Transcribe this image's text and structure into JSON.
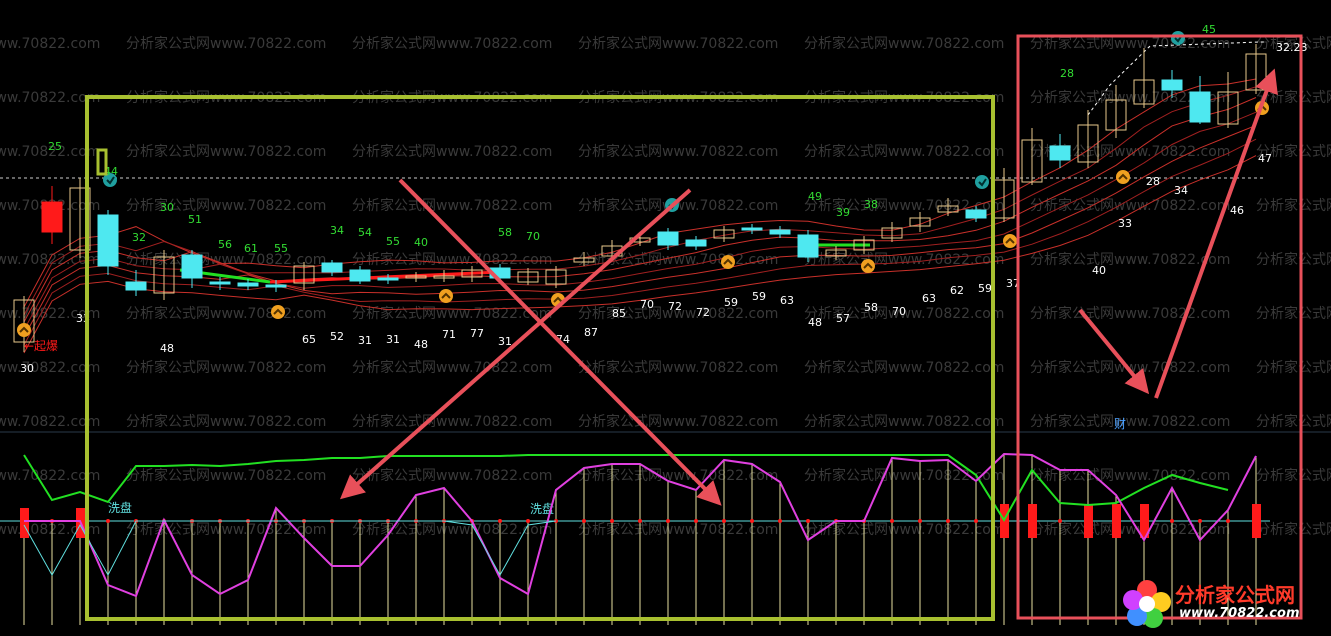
{
  "colors": {
    "background": "#000000",
    "bull_candle": "#e8c98c",
    "bear_candle": "#4ee8f0",
    "up_bar_red": "#ff1a1a",
    "ma_band": "#c8302a",
    "green_line": "#22e022",
    "magenta_line": "#e040e0",
    "cyan_line": "#60e0e0",
    "annotation_red": "#e8505a",
    "highlight_box_green": "#a8c030",
    "highlight_box_red": "#e8505a",
    "watermark": "#3a3a3a",
    "label_green": "#33dd33",
    "label_white": "#ffffff"
  },
  "watermark_text": "分析家公式网www.70822.com",
  "chart_data": {
    "type": "candlestick",
    "candles": [
      {
        "o": 300,
        "c": 342,
        "h": 352,
        "l": 296,
        "bull": true
      },
      {
        "o": 232,
        "c": 202,
        "h": 244,
        "l": 186,
        "bull": false,
        "red": true
      },
      {
        "o": 188,
        "c": 250,
        "h": 258,
        "l": 178,
        "bull": true
      },
      {
        "o": 215,
        "c": 266,
        "h": 275,
        "l": 210,
        "bull": false
      },
      {
        "o": 282,
        "c": 290,
        "h": 296,
        "l": 270,
        "bull": false
      },
      {
        "o": 293,
        "c": 257,
        "h": 300,
        "l": 250,
        "bull": true
      },
      {
        "o": 255,
        "c": 278,
        "h": 288,
        "l": 250,
        "bull": false
      },
      {
        "o": 282,
        "c": 283,
        "h": 290,
        "l": 277,
        "bull": false
      },
      {
        "o": 283,
        "c": 286,
        "h": 290,
        "l": 279,
        "bull": false
      },
      {
        "o": 285,
        "c": 286,
        "h": 292,
        "l": 280,
        "bull": false
      },
      {
        "o": 283,
        "c": 266,
        "h": 290,
        "l": 262,
        "bull": true
      },
      {
        "o": 263,
        "c": 272,
        "h": 276,
        "l": 260,
        "bull": false
      },
      {
        "o": 270,
        "c": 281,
        "h": 284,
        "l": 266,
        "bull": false
      },
      {
        "o": 278,
        "c": 280,
        "h": 284,
        "l": 274,
        "bull": false
      },
      {
        "o": 278,
        "c": 276,
        "h": 282,
        "l": 272,
        "bull": true
      },
      {
        "o": 276,
        "c": 276,
        "h": 282,
        "l": 270,
        "bull": true
      },
      {
        "o": 277,
        "c": 270,
        "h": 282,
        "l": 266,
        "bull": true
      },
      {
        "o": 268,
        "c": 278,
        "h": 282,
        "l": 264,
        "bull": false
      },
      {
        "o": 282,
        "c": 272,
        "h": 285,
        "l": 268,
        "bull": true
      },
      {
        "o": 284,
        "c": 270,
        "h": 288,
        "l": 266,
        "bull": true
      },
      {
        "o": 262,
        "c": 258,
        "h": 266,
        "l": 252,
        "bull": true
      },
      {
        "o": 256,
        "c": 246,
        "h": 260,
        "l": 240,
        "bull": true
      },
      {
        "o": 242,
        "c": 238,
        "h": 246,
        "l": 232,
        "bull": true
      },
      {
        "o": 232,
        "c": 245,
        "h": 250,
        "l": 228,
        "bull": false
      },
      {
        "o": 240,
        "c": 246,
        "h": 250,
        "l": 236,
        "bull": false
      },
      {
        "o": 238,
        "c": 230,
        "h": 242,
        "l": 226,
        "bull": true
      },
      {
        "o": 228,
        "c": 230,
        "h": 234,
        "l": 224,
        "bull": false
      },
      {
        "o": 230,
        "c": 234,
        "h": 238,
        "l": 226,
        "bull": false
      },
      {
        "o": 235,
        "c": 257,
        "h": 262,
        "l": 230,
        "bull": false
      },
      {
        "o": 256,
        "c": 250,
        "h": 260,
        "l": 246,
        "bull": true
      },
      {
        "o": 250,
        "c": 240,
        "h": 254,
        "l": 236,
        "bull": true
      },
      {
        "o": 238,
        "c": 228,
        "h": 242,
        "l": 222,
        "bull": true
      },
      {
        "o": 226,
        "c": 218,
        "h": 232,
        "l": 212,
        "bull": true
      },
      {
        "o": 212,
        "c": 206,
        "h": 216,
        "l": 198,
        "bull": true
      },
      {
        "o": 210,
        "c": 218,
        "h": 222,
        "l": 206,
        "bull": false
      },
      {
        "o": 218,
        "c": 180,
        "h": 222,
        "l": 168,
        "bull": true
      },
      {
        "o": 182,
        "c": 140,
        "h": 185,
        "l": 128,
        "bull": true
      },
      {
        "o": 146,
        "c": 160,
        "h": 168,
        "l": 134,
        "bull": false
      },
      {
        "o": 162,
        "c": 125,
        "h": 168,
        "l": 110,
        "bull": true
      },
      {
        "o": 130,
        "c": 100,
        "h": 138,
        "l": 85,
        "bull": true
      },
      {
        "o": 104,
        "c": 80,
        "h": 108,
        "l": 48,
        "bull": true
      },
      {
        "o": 80,
        "c": 90,
        "h": 98,
        "l": 70,
        "bull": false
      },
      {
        "o": 92,
        "c": 122,
        "h": 124,
        "l": 76,
        "bull": false
      },
      {
        "o": 124,
        "c": 92,
        "h": 128,
        "l": 72,
        "bull": true
      },
      {
        "o": 90,
        "c": 54,
        "h": 94,
        "l": 44,
        "bull": true
      }
    ],
    "labels": [
      {
        "t": "25",
        "c": "green"
      },
      {
        "t": "44",
        "c": "green"
      },
      {
        "t": "30",
        "c": "green"
      },
      {
        "t": "51",
        "c": "green"
      },
      {
        "t": "32",
        "c": "green"
      },
      {
        "t": "56",
        "c": "green"
      },
      {
        "t": "61",
        "c": "green"
      },
      {
        "t": "55",
        "c": "green"
      },
      {
        "t": "34",
        "c": "green"
      },
      {
        "t": "54",
        "c": "green"
      },
      {
        "t": "55",
        "c": "green"
      },
      {
        "t": "40",
        "c": "green"
      },
      {
        "t": "58",
        "c": "green"
      },
      {
        "t": "70",
        "c": "green"
      },
      {
        "t": "49",
        "c": "green"
      },
      {
        "t": "39",
        "c": "green"
      },
      {
        "t": "38",
        "c": "green"
      },
      {
        "t": "28",
        "c": "green"
      },
      {
        "t": "45",
        "c": "green"
      },
      {
        "t": "32.23",
        "c": "white"
      },
      {
        "t": "33",
        "c": "white"
      },
      {
        "t": "48",
        "c": "white"
      },
      {
        "t": "30",
        "c": "white"
      },
      {
        "t": "65",
        "c": "white"
      },
      {
        "t": "52",
        "c": "white"
      },
      {
        "t": "31",
        "c": "white"
      },
      {
        "t": "31",
        "c": "white"
      },
      {
        "t": "48",
        "c": "white"
      },
      {
        "t": "71",
        "c": "white"
      },
      {
        "t": "77",
        "c": "white"
      },
      {
        "t": "31",
        "c": "white"
      },
      {
        "t": "74",
        "c": "white"
      },
      {
        "t": "87",
        "c": "white"
      },
      {
        "t": "85",
        "c": "white"
      },
      {
        "t": "70",
        "c": "white"
      },
      {
        "t": "72",
        "c": "white"
      },
      {
        "t": "72",
        "c": "white"
      },
      {
        "t": "59",
        "c": "white"
      },
      {
        "t": "59",
        "c": "white"
      },
      {
        "t": "63",
        "c": "white"
      },
      {
        "t": "48",
        "c": "white"
      },
      {
        "t": "57",
        "c": "white"
      },
      {
        "t": "58",
        "c": "white"
      },
      {
        "t": "70",
        "c": "white"
      },
      {
        "t": "63",
        "c": "white"
      },
      {
        "t": "62",
        "c": "white"
      },
      {
        "t": "59",
        "c": "white"
      },
      {
        "t": "37",
        "c": "white"
      },
      {
        "t": "40",
        "c": "white"
      },
      {
        "t": "33",
        "c": "white"
      },
      {
        "t": "28",
        "c": "white"
      },
      {
        "t": "34",
        "c": "white"
      },
      {
        "t": "46",
        "c": "white"
      },
      {
        "t": "47",
        "c": "white"
      }
    ],
    "text_marks": {
      "qibao": "←起爆",
      "xipan_1": "洗盘",
      "xipan_2": "洗盘",
      "cai": "财"
    },
    "lower_panel": {
      "green_line": [
        455,
        500,
        492,
        502,
        466,
        466,
        465,
        466,
        464,
        461,
        460,
        458,
        458,
        456,
        456,
        456,
        456,
        456,
        455,
        455,
        455,
        455,
        455,
        455,
        455,
        455,
        455,
        455,
        455,
        455,
        455,
        455,
        455,
        455,
        475,
        520,
        470,
        503,
        505,
        503,
        488,
        475,
        483,
        490
      ],
      "magenta_line": [
        521,
        521,
        521,
        585,
        596,
        520,
        575,
        594,
        580,
        508,
        538,
        566,
        566,
        535,
        495,
        488,
        521,
        578,
        594,
        490,
        468,
        464,
        464,
        481,
        490,
        460,
        464,
        482,
        540,
        521,
        521,
        458,
        461,
        460,
        481,
        454,
        455,
        470,
        470,
        495,
        540,
        488,
        540,
        510,
        456
      ],
      "cyan_line": [
        525,
        575,
        525,
        575,
        521,
        521,
        521,
        521,
        521,
        521,
        521,
        521,
        521,
        521,
        521,
        521,
        525,
        575,
        525,
        521
      ],
      "red_bars": [
        true,
        false,
        true,
        false,
        false,
        false,
        false,
        false,
        false,
        false,
        false,
        false,
        false,
        false,
        false,
        false,
        false,
        false,
        false,
        false,
        false,
        false,
        false,
        false,
        false,
        false,
        false,
        false,
        false,
        false,
        false,
        false,
        false,
        false,
        false,
        true,
        true,
        false,
        true,
        true,
        true,
        false,
        false,
        false,
        true
      ]
    }
  },
  "logo": {
    "name": "分析家公式网",
    "url": "www.70822.com"
  }
}
